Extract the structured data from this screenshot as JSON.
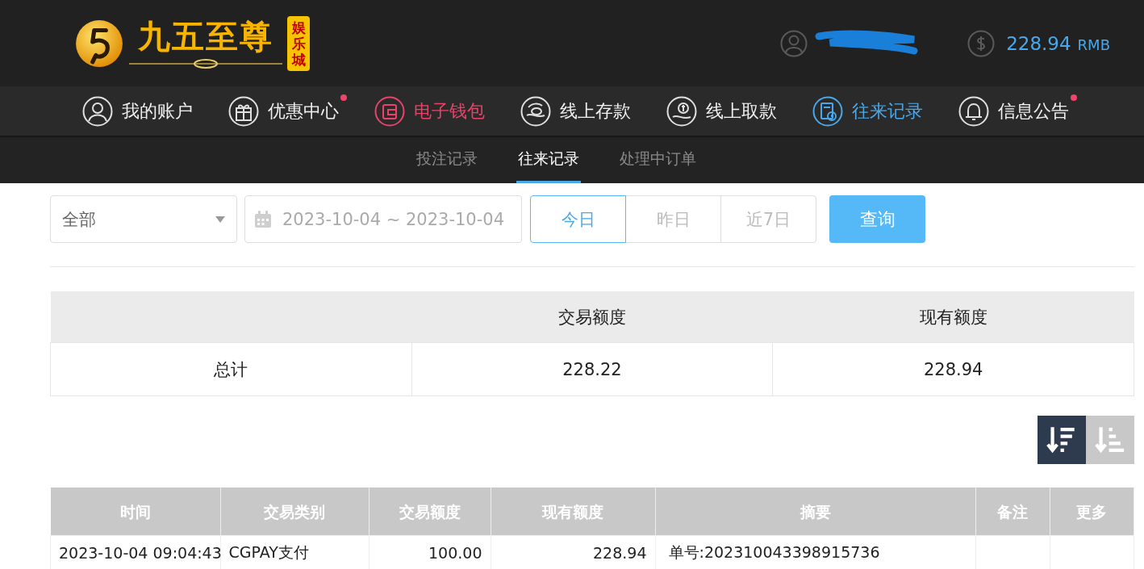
{
  "header": {
    "logo": {
      "name": "九五至尊",
      "badge": "娱乐城"
    },
    "user": {
      "name_hidden": true
    },
    "balance": {
      "amount": "228.94",
      "currency": "RMB"
    }
  },
  "nav": [
    {
      "label": "我的账户",
      "selected": false,
      "highlighted": false,
      "dot": false
    },
    {
      "label": "优惠中心",
      "selected": false,
      "highlighted": false,
      "dot": true
    },
    {
      "label": "电子钱包",
      "selected": false,
      "highlighted": true,
      "dot": false
    },
    {
      "label": "线上存款",
      "selected": false,
      "highlighted": false,
      "dot": false
    },
    {
      "label": "线上取款",
      "selected": false,
      "highlighted": false,
      "dot": false
    },
    {
      "label": "往来记录",
      "selected": true,
      "highlighted": false,
      "dot": false
    },
    {
      "label": "信息公告",
      "selected": false,
      "highlighted": false,
      "dot": true
    }
  ],
  "subtabs": [
    {
      "label": "投注记录",
      "selected": false
    },
    {
      "label": "往来记录",
      "selected": true
    },
    {
      "label": "处理中订单",
      "selected": false
    }
  ],
  "filters": {
    "type_select": {
      "value": "全部"
    },
    "date_range": {
      "value": "2023-10-04 ~ 2023-10-04"
    },
    "quick_ranges": [
      {
        "label": "今日",
        "selected": true
      },
      {
        "label": "昨日",
        "selected": false
      },
      {
        "label": "近7日",
        "selected": false
      }
    ],
    "query_button": "查询"
  },
  "summary": {
    "columns": [
      "交易额度",
      "现有额度"
    ],
    "rows": [
      {
        "label": "总计",
        "values": [
          "228.22",
          "228.94"
        ]
      }
    ]
  },
  "sort_buttons": [
    {
      "selected": true
    },
    {
      "selected": false
    }
  ],
  "table": {
    "columns": [
      "时间",
      "交易类别",
      "交易额度",
      "现有额度",
      "摘要",
      "备注",
      "更多"
    ],
    "rows": [
      {
        "cells": [
          "2023-10-04 09:04:43",
          "CGPAY支付",
          "100.00",
          "228.94",
          "单号:202310043398915736"
        ]
      }
    ]
  }
}
